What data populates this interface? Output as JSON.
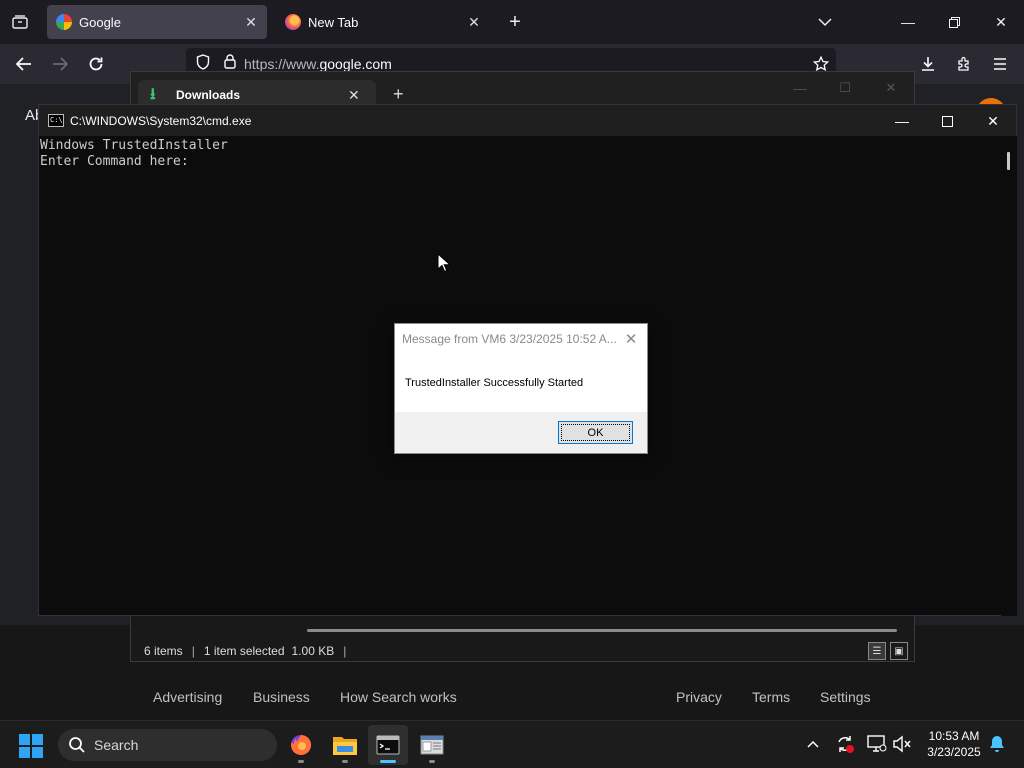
{
  "browser": {
    "tabs": [
      {
        "title": "Google",
        "active": true
      },
      {
        "title": "New Tab",
        "active": false
      }
    ],
    "url_prefix": "https://www.",
    "url_domain": "google.com",
    "page_partial_text": "Ab",
    "footer_links_left": [
      "Advertising",
      "Business",
      "How Search works"
    ],
    "footer_links_right": [
      "Privacy",
      "Terms",
      "Settings"
    ]
  },
  "explorer": {
    "tab_title": "Downloads",
    "status_items": "6 items",
    "status_selected": "1 item selected",
    "status_size": "1.00 KB"
  },
  "cmd": {
    "title": "C:\\WINDOWS\\System32\\cmd.exe",
    "icon_text": "C:\\",
    "lines": "Windows TrustedInstaller\nEnter Command here:"
  },
  "msgbox": {
    "title": "Message from VM6 3/23/2025 10:52 A...",
    "message": "TrustedInstaller Successfully Started",
    "ok_label": "OK"
  },
  "taskbar": {
    "search_label": "Search",
    "time": "10:53 AM",
    "date": "3/23/2025",
    "accent_color": "#4cc2ff"
  }
}
